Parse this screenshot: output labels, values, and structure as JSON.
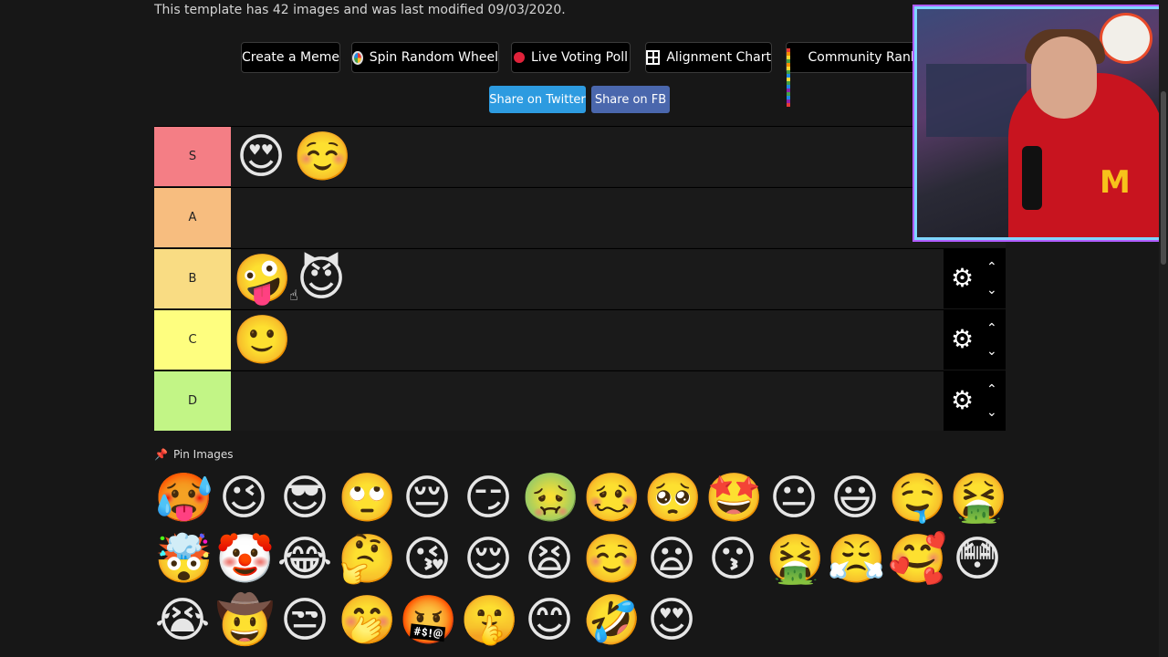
{
  "info": {
    "text": "This template has 42 images and was last modified 09/03/2020."
  },
  "toolbar": {
    "create_meme": "Create a Meme",
    "spin_wheel": "Spin Random Wheel",
    "live_poll": "Live Voting Poll",
    "alignment": "Alignment Chart",
    "community": "Community Rank"
  },
  "share": {
    "twitter": "Share on Twitter",
    "fb": "Share on FB",
    "twitter_color": "#2d9be0",
    "fb_color": "#4a67ad"
  },
  "tiers": [
    {
      "label": "S",
      "color": "#f47e85",
      "items": [
        "😍",
        "☺️"
      ]
    },
    {
      "label": "A",
      "color": "#f7bd7f",
      "items": []
    },
    {
      "label": "B",
      "color": "#f9dc83",
      "items": [
        "🤪",
        "😈"
      ]
    },
    {
      "label": "C",
      "color": "#fefe7f",
      "items": [
        "🙂"
      ]
    },
    {
      "label": "D",
      "color": "#c2f586",
      "items": []
    }
  ],
  "pin": {
    "title": "Pin Images"
  },
  "pool": [
    "🥵",
    "😉",
    "😎",
    "🙄",
    "😔",
    "😏",
    "🤢",
    "🥴",
    "🥺",
    "🤩",
    "😐",
    "😃",
    "🤤",
    "🤮",
    "🤯",
    "🤡",
    "😂",
    "🤔",
    "😘",
    "😌",
    "😫",
    "☺️",
    "😦",
    "😗",
    "🤮",
    "😤",
    "🥰",
    "😳",
    "😭",
    "🤠",
    "😒",
    "🤭",
    "🤬",
    "🤫",
    "😊",
    "🤣",
    "😍"
  ],
  "controls": {
    "gear": "⚙",
    "up": "⌃",
    "down": "⌄"
  }
}
